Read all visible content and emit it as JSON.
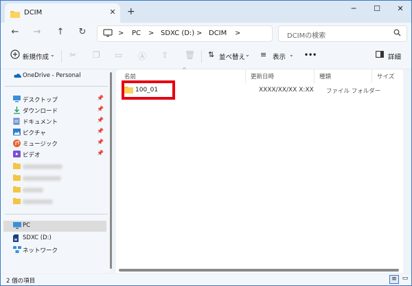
{
  "tab": {
    "title": "DCIM",
    "close": "✕",
    "new": "+"
  },
  "window_controls": {
    "minimize": "─",
    "maximize": "☐",
    "close": "✕"
  },
  "nav": {
    "back": "←",
    "forward": "→",
    "up": "↑",
    "refresh": "↻"
  },
  "breadcrumb": {
    "pc": "PC",
    "drive": "SDXC (D:)",
    "folder": "DCIM",
    "sep": ">"
  },
  "search": {
    "placeholder": "DCIMの検索"
  },
  "toolbar": {
    "new_label": "新規作成",
    "sort_label": "並べ替え",
    "view_label": "表示",
    "more_label": "•••",
    "details_label": "詳細"
  },
  "sidebar": {
    "onedrive": "OneDrive - Personal",
    "quick": [
      {
        "label": "デスクトップ",
        "icon": "desktop-icon"
      },
      {
        "label": "ダウンロード",
        "icon": "download-icon"
      },
      {
        "label": "ドキュメント",
        "icon": "document-icon"
      },
      {
        "label": "ピクチャ",
        "icon": "pictures-icon"
      },
      {
        "label": "ミュージック",
        "icon": "music-icon"
      },
      {
        "label": "ビデオ",
        "icon": "video-icon"
      }
    ],
    "pc": "PC",
    "drive": "SDXC (D:)",
    "network": "ネットワーク"
  },
  "columns": {
    "name": "名前",
    "date": "更新日時",
    "type": "種類",
    "size": "サイズ"
  },
  "files": [
    {
      "name": "100_01",
      "date": "XXXX/XX/XX X:XX",
      "type": "ファイル フォルダー"
    }
  ],
  "status": {
    "count": "2 個の項目"
  },
  "colors": {
    "accent": "#3a78c8",
    "highlight": "#e60012",
    "folder": "#f4c542"
  }
}
